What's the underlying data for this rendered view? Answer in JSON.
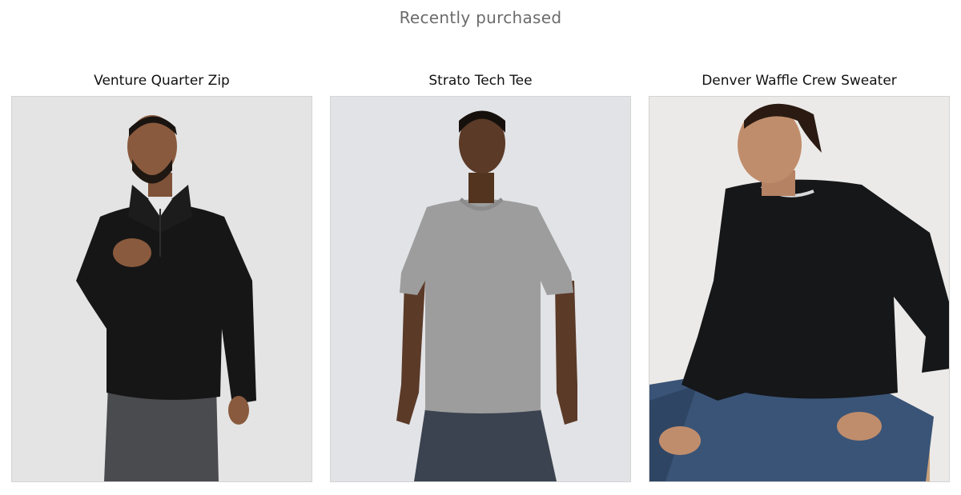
{
  "section": {
    "title": "Recently purchased"
  },
  "products": [
    {
      "name": "Venture Quarter Zip",
      "image_icon": "model-black-quarter-zip-image",
      "colors": {
        "background": "#e4e4e4",
        "garment": "#161616",
        "pants": "#4a4b4e",
        "skin": "#8a5a3e"
      }
    },
    {
      "name": "Strato Tech Tee",
      "image_icon": "model-grey-tee-image",
      "colors": {
        "background": "#e2e3e6",
        "garment": "#9d9d9d",
        "shorts": "#3b4350",
        "skin": "#5b3a28"
      }
    },
    {
      "name": "Denver Waffle Crew Sweater",
      "image_icon": "model-black-crew-sweater-image",
      "colors": {
        "background": "#eceae8",
        "garment": "#151719",
        "jeans": "#3a5477",
        "skin": "#c08d6c"
      }
    }
  ]
}
